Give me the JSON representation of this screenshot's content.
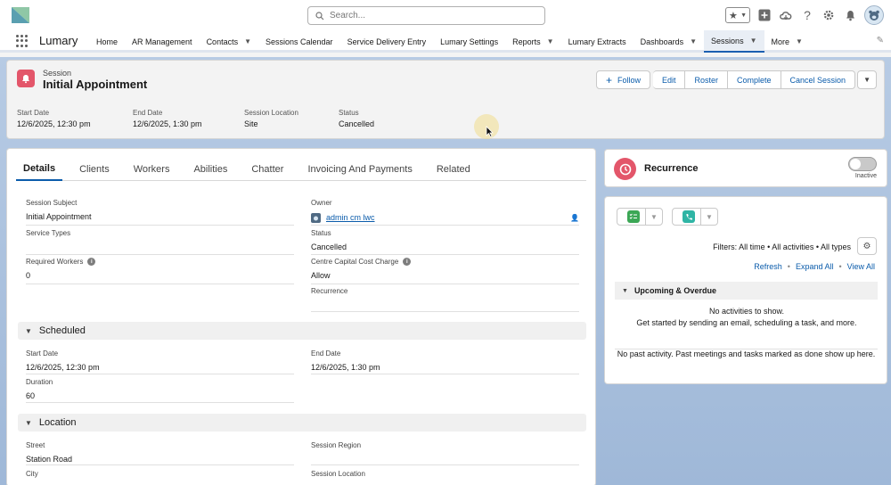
{
  "header": {
    "search_placeholder": "Search..."
  },
  "nav": {
    "app_name": "Lumary",
    "items": [
      {
        "label": "Home",
        "has_menu": false
      },
      {
        "label": "AR Management",
        "has_menu": false
      },
      {
        "label": "Contacts",
        "has_menu": true
      },
      {
        "label": "Sessions Calendar",
        "has_menu": false
      },
      {
        "label": "Service Delivery Entry",
        "has_menu": false
      },
      {
        "label": "Lumary Settings",
        "has_menu": false
      },
      {
        "label": "Reports",
        "has_menu": true
      },
      {
        "label": "Lumary Extracts",
        "has_menu": false
      },
      {
        "label": "Dashboards",
        "has_menu": true
      },
      {
        "label": "Sessions",
        "has_menu": true,
        "active": true
      },
      {
        "label": "More",
        "has_menu": true
      }
    ]
  },
  "record": {
    "object_type": "Session",
    "title": "Initial Appointment",
    "actions": {
      "follow": "Follow",
      "edit": "Edit",
      "roster": "Roster",
      "complete": "Complete",
      "cancel_session": "Cancel Session"
    },
    "highlights": [
      {
        "label": "Start Date",
        "value": "12/6/2025, 12:30 pm"
      },
      {
        "label": "End Date",
        "value": "12/6/2025, 1:30 pm"
      },
      {
        "label": "Session Location",
        "value": "Site"
      },
      {
        "label": "Status",
        "value": "Cancelled"
      }
    ]
  },
  "tabs": [
    "Details",
    "Clients",
    "Workers",
    "Abilities",
    "Chatter",
    "Invoicing And Payments",
    "Related"
  ],
  "details": {
    "session_subject": {
      "label": "Session Subject",
      "value": "Initial Appointment"
    },
    "owner": {
      "label": "Owner",
      "value": "admin cm lwc"
    },
    "service_types": {
      "label": "Service Types",
      "value": ""
    },
    "status": {
      "label": "Status",
      "value": "Cancelled"
    },
    "required_workers": {
      "label": "Required Workers",
      "value": "0"
    },
    "centre_capital_cost_charge": {
      "label": "Centre Capital Cost Charge",
      "value": "Allow"
    },
    "recurrence": {
      "label": "Recurrence",
      "value": ""
    }
  },
  "scheduled": {
    "section_label": "Scheduled",
    "start_date": {
      "label": "Start Date",
      "value": "12/6/2025, 12:30 pm"
    },
    "end_date": {
      "label": "End Date",
      "value": "12/6/2025, 1:30 pm"
    },
    "duration": {
      "label": "Duration",
      "value": "60"
    }
  },
  "location": {
    "section_label": "Location",
    "street": {
      "label": "Street",
      "value": "Station Road"
    },
    "session_region": {
      "label": "Session Region",
      "value": ""
    },
    "city": {
      "label": "City",
      "value": ""
    },
    "session_location": {
      "label": "Session Location",
      "value": ""
    }
  },
  "recurrence_card": {
    "title": "Recurrence",
    "toggle_label": "Inactive",
    "toggle_on": false
  },
  "activity": {
    "filters_text": "Filters: All time • All activities • All types",
    "refresh": "Refresh",
    "expand_all": "Expand All",
    "view_all": "View All",
    "upcoming_label": "Upcoming & Overdue",
    "no_activities": "No activities to show.",
    "get_started": "Get started by sending an email, scheduling a task, and more.",
    "no_past": "No past activity. Past meetings and tasks marked as done show up here."
  },
  "colors": {
    "accent": "#0b5cab",
    "record_icon": "#e3566a",
    "task_green": "#3ba755",
    "log_call_teal": "#2fb5a5"
  }
}
